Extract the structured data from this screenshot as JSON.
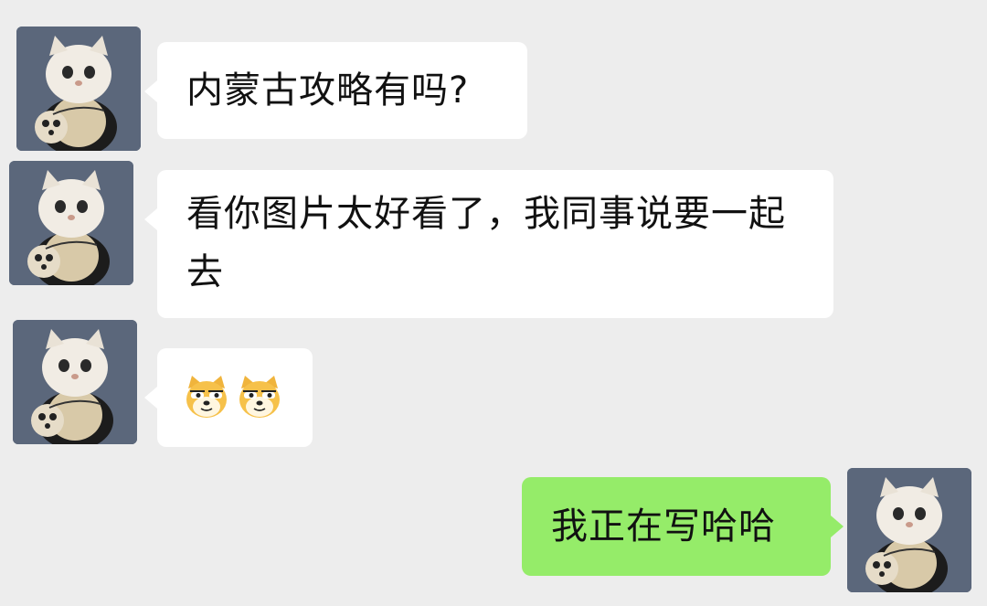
{
  "chat": {
    "messages": [
      {
        "sender": "contact",
        "text": "内蒙古攻略有吗?"
      },
      {
        "sender": "contact",
        "text": "看你图片太好看了，我同事说要一起去"
      },
      {
        "sender": "contact",
        "emojis": [
          "doge-smirk-icon",
          "doge-smirk-icon"
        ]
      },
      {
        "sender": "self",
        "text": "我正在写哈哈"
      }
    ]
  },
  "colors": {
    "background": "#ededed",
    "incoming_bubble": "#ffffff",
    "outgoing_bubble": "#95ec69",
    "avatar_bg": "#5c6a80"
  }
}
